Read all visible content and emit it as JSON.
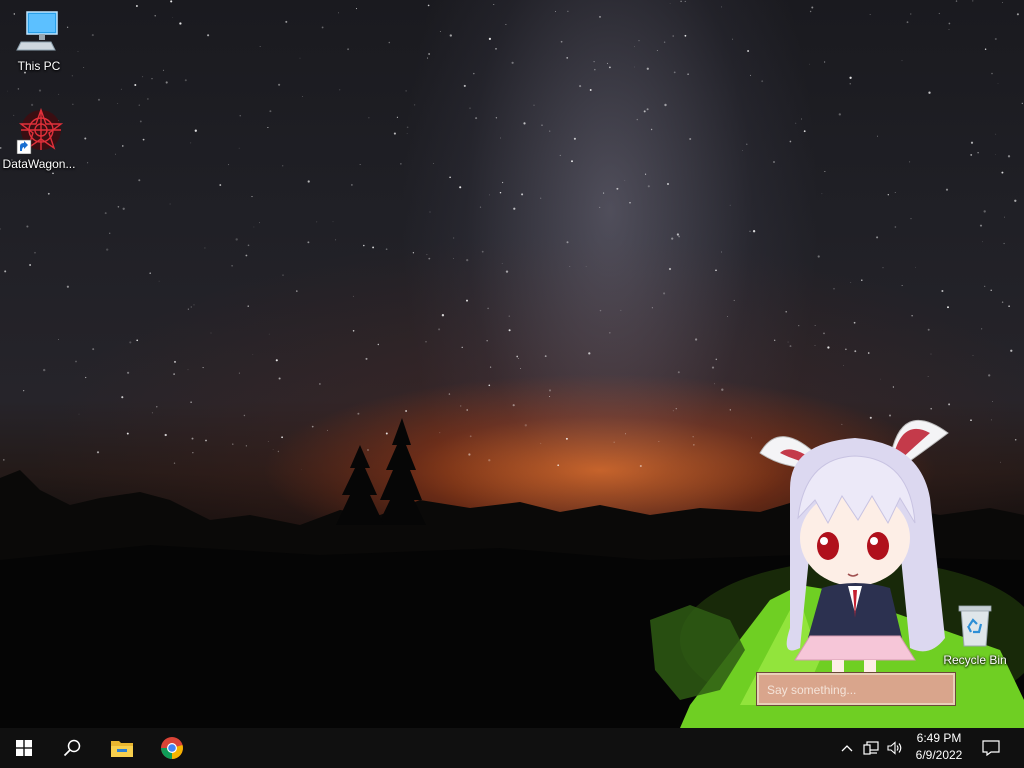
{
  "desktop": {
    "icons": [
      {
        "label": "This PC",
        "icon": "this-pc-icon"
      },
      {
        "label": "DataWagon...",
        "icon": "datawagon-icon"
      },
      {
        "label": "Recycle Bin",
        "icon": "recycle-bin-icon"
      }
    ],
    "mascot": {
      "input_placeholder": "Say something..."
    }
  },
  "taskbar": {
    "pinned": [
      "start-icon",
      "search-icon",
      "file-explorer-icon",
      "chrome-icon"
    ],
    "tray_icons": [
      "chevron-up-icon",
      "network-icon",
      "volume-icon"
    ],
    "time": "6:49 PM",
    "date": "6/9/2022",
    "notifications_icon": "action-center-icon"
  },
  "colors": {
    "taskbar_bg": "#101010",
    "say_box_bg": "#d9a58c",
    "tent_green": "#7bd62a"
  }
}
